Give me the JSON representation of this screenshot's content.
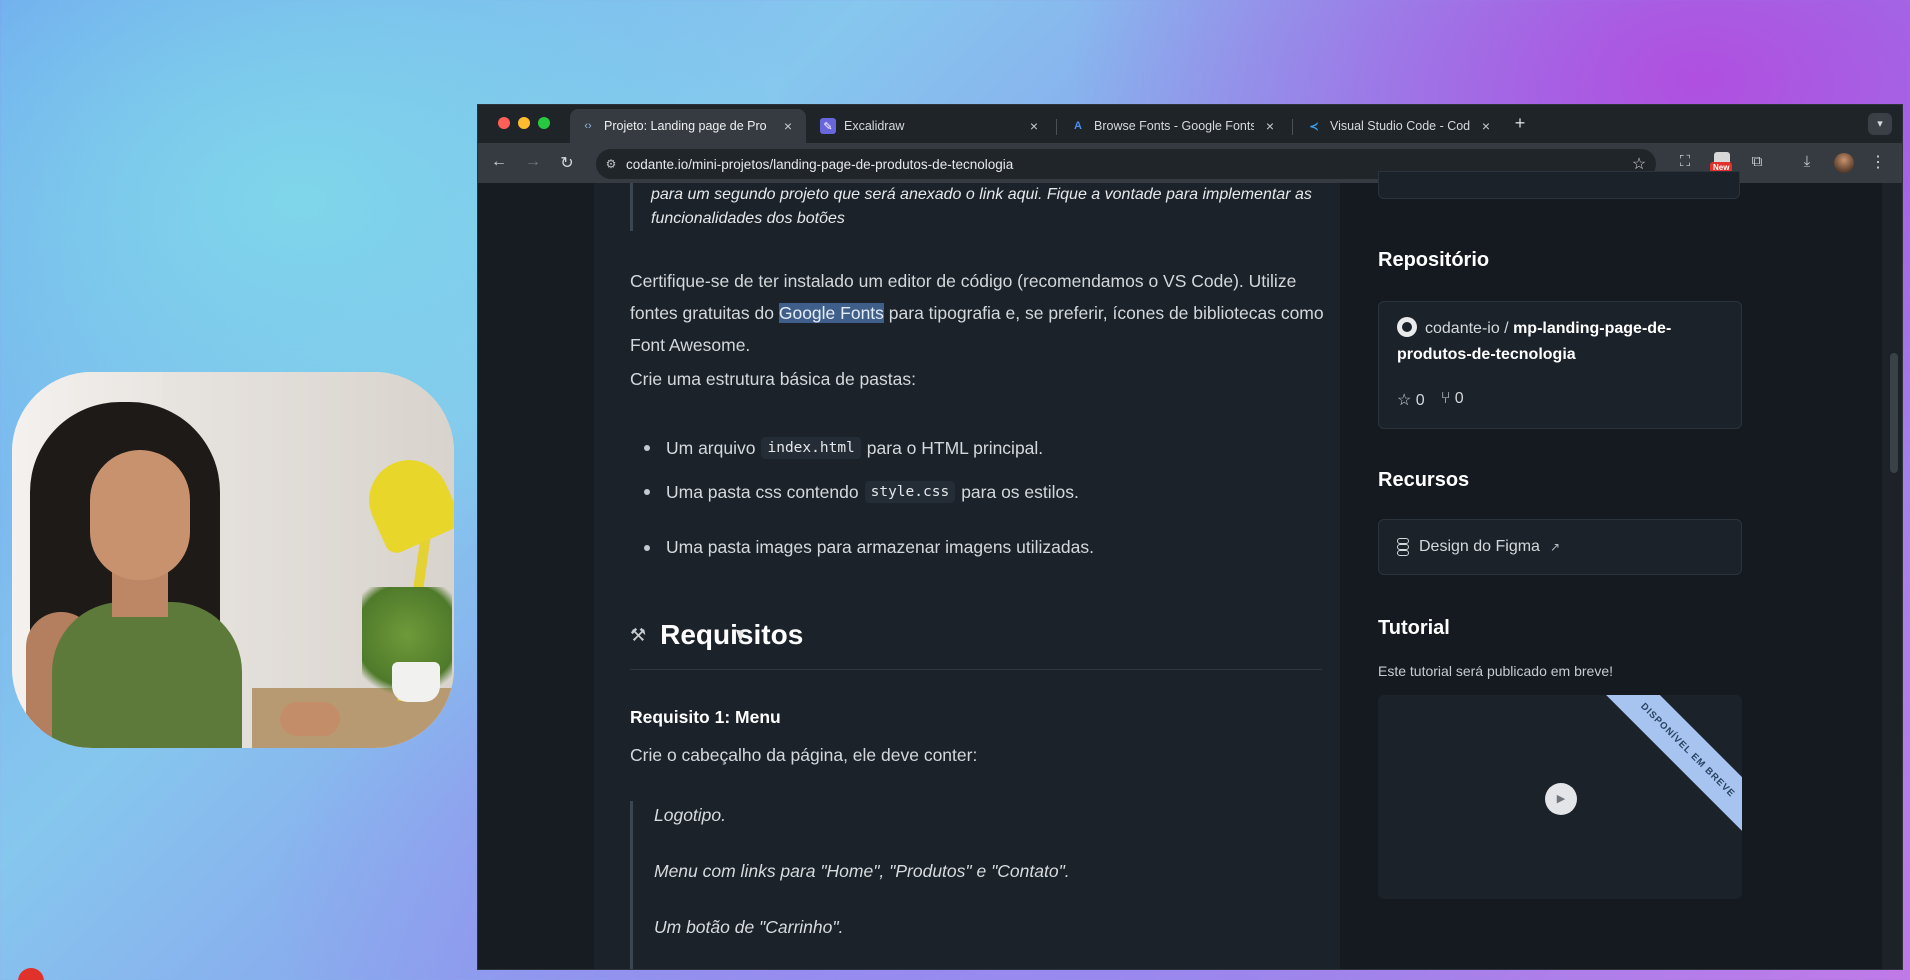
{
  "browser": {
    "tabs": [
      {
        "title": "Projeto: Landing page de Pro",
        "icon": "code-icon",
        "active": true
      },
      {
        "title": "Excalidraw",
        "icon": "excalidraw-icon",
        "active": false
      },
      {
        "title": "Browse Fonts - Google Fonts",
        "icon": "google-fonts-icon",
        "active": false
      },
      {
        "title": "Visual Studio Code - Code Ed",
        "icon": "vscode-icon",
        "active": false
      }
    ],
    "new_tab": "+",
    "close": "×",
    "url": "codante.io/mini-projetos/landing-page-de-produtos-de-tecnologia",
    "ext_badge": "New"
  },
  "article": {
    "quote_top": "para um segundo projeto que será anexado o link aqui. Fique a vontade para implementar as funcionalidades dos botões",
    "para1_before": "Certifique-se de ter instalado um editor de código (recomendamos o VS Code). Utilize fontes gratuitas do ",
    "para1_highlight": "Google Fonts",
    "para1_after": " para tipografia e, se preferir, ícones de bibliotecas como Font Awesome.",
    "para2": "Crie uma estrutura básica de pastas:",
    "bullets": [
      {
        "before": "Um arquivo",
        "code": "index.html",
        "after": "para o HTML principal."
      },
      {
        "before": "Uma pasta css contendo",
        "code": "style.css",
        "after": "para os estilos."
      },
      {
        "before": "Uma pasta images para armazenar imagens utilizadas.",
        "code": "",
        "after": ""
      }
    ],
    "section_title": "Requisitos",
    "section_icon": "hammer-icon",
    "req1_title": "Requisito 1: Menu",
    "req1_desc": "Crie o cabeçalho da página, ele deve conter:",
    "req1_items": [
      "Logotipo.",
      "Menu com links para \"Home\", \"Produtos\" e \"Contato\".",
      "Um botão de \"Carrinho\"."
    ]
  },
  "sidebar": {
    "repo_heading": "Repositório",
    "repo_owner": "codante-io / ",
    "repo_name": "mp-landing-page-de-produtos-de-tecnologia",
    "stars": "0",
    "forks": "0",
    "resources_heading": "Recursos",
    "figma_link": "Design do Figma",
    "tutorial_heading": "Tutorial",
    "tutorial_desc": "Este tutorial será publicado em breve!",
    "ribbon": "DISPONÍVEL EM BREVE"
  },
  "colors": {
    "page_bg": "#141a20",
    "content_bg": "#1b222a",
    "highlight": "#3f5f8a",
    "ribbon": "#a7c4f0"
  }
}
